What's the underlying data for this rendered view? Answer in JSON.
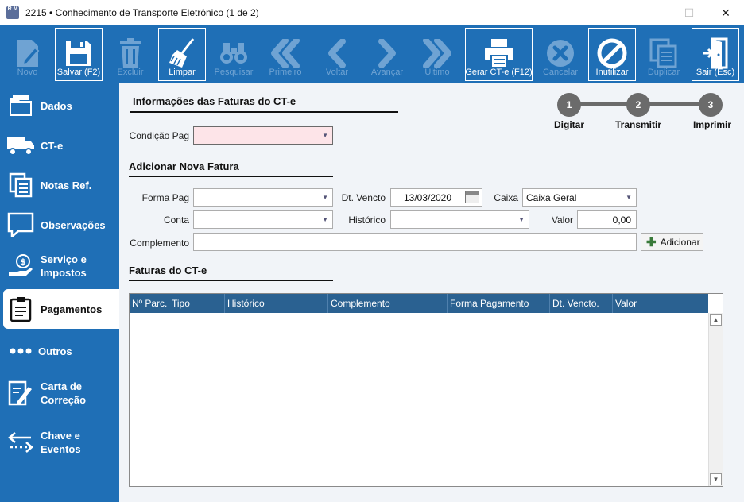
{
  "window": {
    "app_icon_text": "R M",
    "title": "2215 • Conhecimento de Transporte Eletrônico (1 de 2)",
    "minimize": "—",
    "maximize": "☐",
    "close": "✕"
  },
  "toolbar": {
    "novo": "Novo",
    "salvar": "Salvar (F2)",
    "excluir": "Excluir",
    "limpar": "Limpar",
    "pesquisar": "Pesquisar",
    "primeiro": "Primeiro",
    "voltar": "Voltar",
    "avancar": "Avançar",
    "ultimo": "Último",
    "gerar": "Gerar CT-e (F12)",
    "cancelar": "Cancelar",
    "inutilizar": "Inutilizar",
    "duplicar": "Duplicar",
    "sair": "Sair (Esc)"
  },
  "sidebar": {
    "dados": "Dados",
    "cte": "CT-e",
    "notas_line1": "Notas Ref.",
    "observacoes": "Observações",
    "servico_line1": "Serviço e",
    "servico_line2": "Impostos",
    "pagamentos": "Pagamentos",
    "outros": "Outros",
    "carta_line1": "Carta de",
    "carta_line2": "Correção",
    "chave_line1": "Chave e",
    "chave_line2": "Eventos"
  },
  "sections": {
    "faturas_info": "Informações das Faturas do CT-e",
    "nova_fatura": "Adicionar Nova Fatura",
    "faturas_cte": "Faturas do CT-e"
  },
  "steps": {
    "s1_num": "1",
    "s1_lbl": "Digitar",
    "s2_num": "2",
    "s2_lbl": "Transmitir",
    "s3_num": "3",
    "s3_lbl": "Imprimir"
  },
  "form": {
    "condicao_label": "Condição Pag",
    "condicao_value": "",
    "forma_label": "Forma Pag",
    "forma_value": "",
    "dtvencto_label": "Dt. Vencto",
    "dtvencto_value": "13/03/2020",
    "caixa_label": "Caixa",
    "caixa_value": "Caixa Geral",
    "conta_label": "Conta",
    "conta_value": "",
    "historico_label": "Histórico",
    "historico_value": "",
    "valor_label": "Valor",
    "valor_value": "0,00",
    "complemento_label": "Complemento",
    "complemento_value": "",
    "adicionar": "Adicionar"
  },
  "grid": {
    "columns": [
      "Nº Parc.",
      "Tipo",
      "Histórico",
      "Complemento",
      "Forma Pagamento",
      "Dt. Vencto.",
      "Valor"
    ]
  },
  "colors": {
    "primary": "#1f6fb6",
    "grid_header": "#2a6191",
    "required_field": "#fde4e8"
  }
}
